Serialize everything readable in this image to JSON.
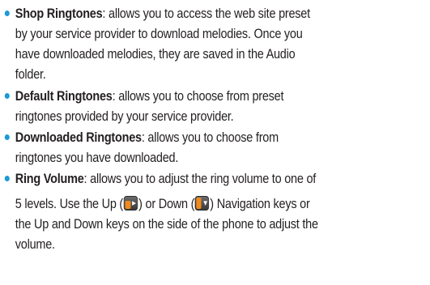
{
  "items": [
    {
      "term": "Shop Ringtones",
      "lines": [
        ": allows you to access the web site preset",
        "by your service provider to download melodies. Once you",
        "have downloaded melodies, they are saved in the Audio",
        "folder."
      ]
    },
    {
      "term": "Default Ringtones",
      "lines": [
        ": allows you to choose from preset",
        "ringtones provided by your service provider."
      ]
    },
    {
      "term": "Downloaded Ringtones",
      "lines": [
        ": allows you to choose from",
        "ringtones you have downloaded."
      ]
    },
    {
      "term": "Ring Volume",
      "lines": [
        ": allows you to adjust the ring volume to one of",
        "5 levels. Use the Up (",
        ") or Down (",
        ") Navigation keys or",
        "the Up and Down keys on the side of the phone to adjust the",
        "volume."
      ],
      "icons": [
        "up-navigation-key-icon",
        "down-navigation-key-icon"
      ]
    }
  ],
  "colors": {
    "bullet": "#1b9ad6",
    "text": "#231f20",
    "key_accent": "#f08a1c"
  }
}
